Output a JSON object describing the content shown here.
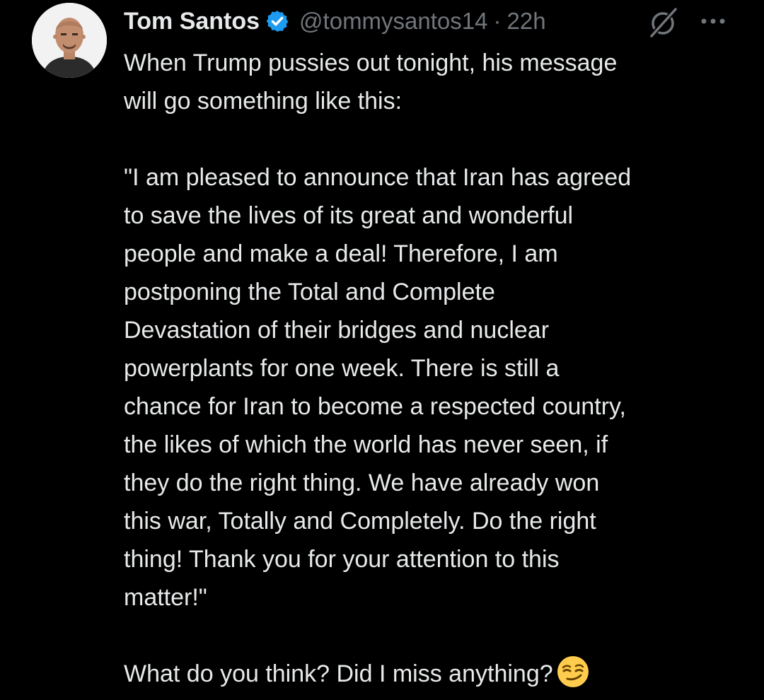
{
  "post": {
    "author_name": "Tom Santos",
    "handle": "@tommysantos14",
    "separator": "·",
    "time": "22h",
    "lines": [
      "When Trump pussies out tonight, his message",
      "will go something like this:",
      "\"I am pleased to announce that Iran has agreed",
      "to save the lives of its great and wonderful",
      "people and make a deal! Therefore, I am",
      "postponing the Total and Complete",
      "Devastation of their bridges and nuclear",
      "powerplants for one week. There is still a",
      "chance for Iran to become a  respected country,",
      "the likes of which the world has never seen, if",
      "they do the right thing. We have already won",
      "this war, Totally and Completely. Do the right",
      "thing! Thank you for your attention to this",
      "matter!\"",
      "What do you think? Did I miss anything?"
    ],
    "emoji": "smirking-face"
  },
  "icons": {
    "verified": "verified-badge-icon",
    "grok": "grok-icon",
    "more": "more-options-icon"
  },
  "colors": {
    "background": "#000000",
    "text": "#e7e9ea",
    "secondary": "#71767b",
    "verified": "#1d9bf0"
  }
}
